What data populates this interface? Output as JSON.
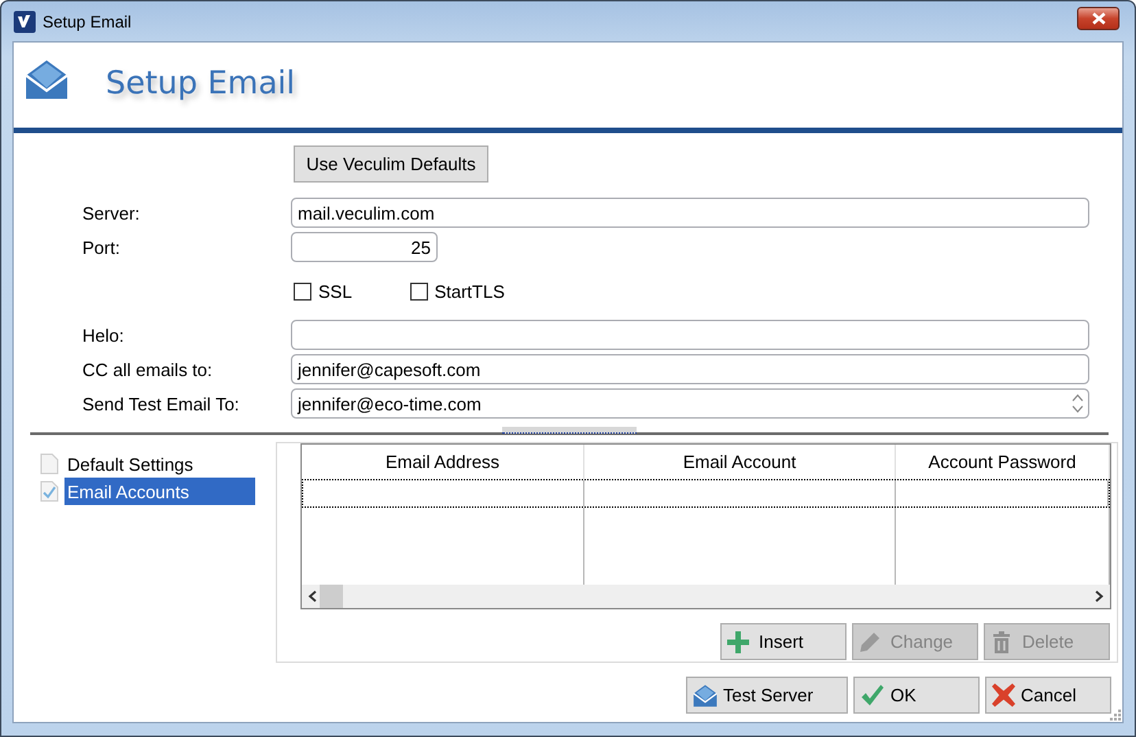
{
  "window": {
    "title": "Setup Email"
  },
  "header": {
    "title": "Setup Email"
  },
  "defaults_button": {
    "label": "Use Veculim Defaults"
  },
  "form_rows": [
    {
      "kind": "text",
      "label": "Server:",
      "value": "mail.veculim.com"
    },
    {
      "kind": "number",
      "label": "Port:",
      "value": "25"
    },
    {
      "kind": "checks",
      "options": [
        {
          "label": "SSL",
          "checked": false
        },
        {
          "label": "StartTLS",
          "checked": false
        }
      ]
    },
    {
      "kind": "text",
      "label": "Helo:"
    },
    {
      "kind": "text",
      "label": "CC all emails to:",
      "value": "jennifer@capesoft.com"
    },
    {
      "kind": "spin",
      "label": "Send Test Email To:",
      "value": "jennifer@eco-time.com"
    }
  ],
  "tree": {
    "items": [
      {
        "label": "Default Settings",
        "checked": false,
        "selected": false
      },
      {
        "label": "Email Accounts",
        "checked": true,
        "selected": true
      }
    ]
  },
  "table": {
    "columns": [
      "Email Address",
      "Email Account",
      "Account Password"
    ]
  },
  "table_buttons": [
    {
      "kind": "insert",
      "label": "Insert",
      "disabled": false
    },
    {
      "kind": "change",
      "label": "Change",
      "disabled": true
    },
    {
      "kind": "delete",
      "label": "Delete",
      "disabled": true
    }
  ],
  "footer_buttons": [
    {
      "kind": "test",
      "label": "Test Server"
    },
    {
      "kind": "ok",
      "label": "OK"
    },
    {
      "kind": "cancel",
      "label": "Cancel"
    }
  ]
}
